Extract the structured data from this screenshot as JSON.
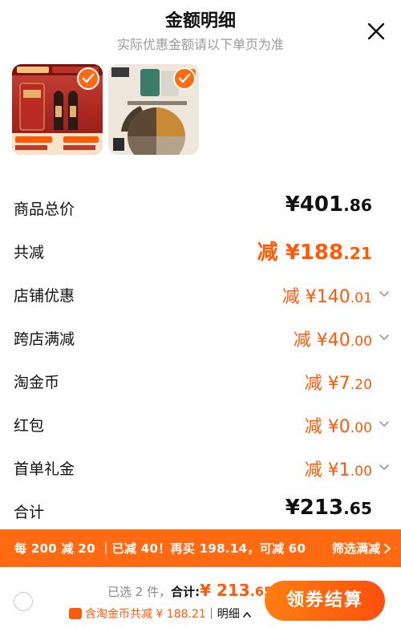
{
  "header": {
    "title": "金额明细",
    "subtitle": "实际优惠金额请以下单页为准"
  },
  "rows": [
    {
      "label": "商品总价",
      "int": "¥401",
      "dec": ".86"
    },
    {
      "label": "共减",
      "int": "减 ¥188",
      "dec": ".21"
    },
    {
      "label": "店铺优惠",
      "int": "减 ¥140",
      "dec": ".01"
    },
    {
      "label": "跨店满减",
      "int": "减 ¥40",
      "dec": ".00"
    },
    {
      "label": "淘金币",
      "int": "减 ¥7",
      "dec": ".20"
    },
    {
      "label": "红包",
      "int": "减 ¥0",
      "dec": ".00"
    },
    {
      "label": "首单礼金",
      "int": "减 ¥1",
      "dec": ".00"
    },
    {
      "label": "合计",
      "int": "¥213",
      "dec": ".65"
    }
  ],
  "banner": {
    "text": "每 200 减 20 ｜已减 40！再买 198.14，可减 60",
    "button": "筛选满减"
  },
  "footer": {
    "selected": "已选 2 件，",
    "total_label": "合计:",
    "total_int": "¥ 213",
    "total_dec": ".65",
    "coin_text": "含淘金币共减 ¥ 188.21",
    "detail_link": "｜明细",
    "pay_button": "领券结算"
  },
  "colors": {
    "accent": "#ff5a0a",
    "banner": "#ff6a12"
  }
}
